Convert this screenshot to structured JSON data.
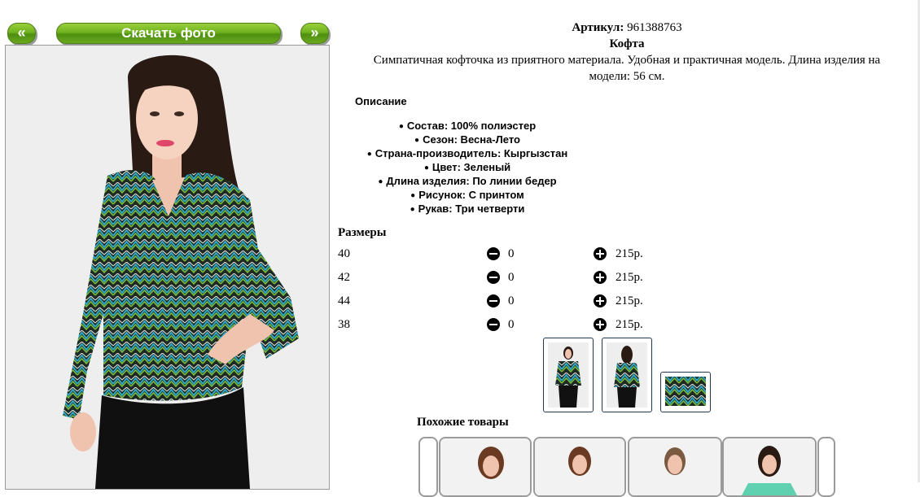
{
  "nav": {
    "prev_label": "«",
    "download_label": "Скачать фото",
    "next_label": "»"
  },
  "product": {
    "article_label": "Артикул:",
    "article_value": "961388763",
    "name": "Кофта",
    "description": "Симпатичная кофточка из приятного материала. Удобная и практичная модель. Длина изделия на модели: 56 см.",
    "details_title": "Описание",
    "specs": [
      "Состав: 100% полиэстер",
      "Сезон: Весна-Лето",
      "Страна-производитель: Кыргызстан",
      "Цвет: Зеленый",
      "Длина изделия: По линии бедер",
      "Рисунок: С принтом",
      "Рукав: Три четверти"
    ]
  },
  "sizes": {
    "title": "Размеры",
    "rows": [
      {
        "size": "40",
        "qty": "0",
        "price": "215р."
      },
      {
        "size": "42",
        "qty": "0",
        "price": "215р."
      },
      {
        "size": "44",
        "qty": "0",
        "price": "215р."
      },
      {
        "size": "38",
        "qty": "0",
        "price": "215р."
      }
    ]
  },
  "similar": {
    "title": "Похожие товары"
  },
  "colors": {
    "button_green": "#6fb21f",
    "thumb_border": "#233a55"
  }
}
